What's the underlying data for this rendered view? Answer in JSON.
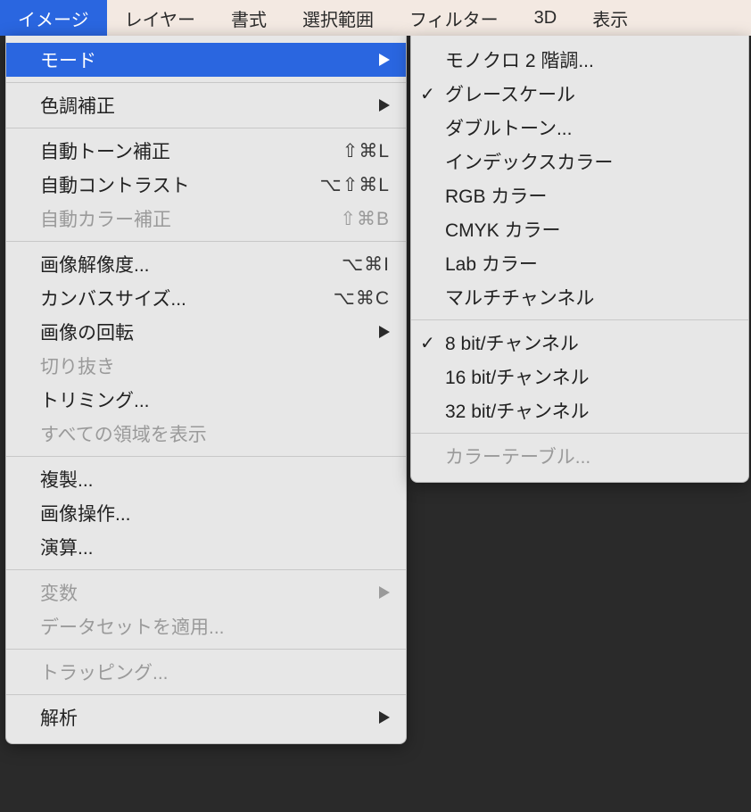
{
  "menubar": {
    "items": [
      {
        "label": "イメージ",
        "selected": true
      },
      {
        "label": "レイヤー"
      },
      {
        "label": "書式"
      },
      {
        "label": "選択範囲"
      },
      {
        "label": "フィルター"
      },
      {
        "label": "3D"
      },
      {
        "label": "表示"
      }
    ]
  },
  "imageMenu": {
    "groups": [
      [
        {
          "label": "モード",
          "submenu": true,
          "highlight": true
        }
      ],
      [
        {
          "label": "色調補正",
          "submenu": true
        }
      ],
      [
        {
          "label": "自動トーン補正",
          "shortcut": "⇧⌘L"
        },
        {
          "label": "自動コントラスト",
          "shortcut": "⌥⇧⌘L"
        },
        {
          "label": "自動カラー補正",
          "shortcut": "⇧⌘B",
          "disabled": true
        }
      ],
      [
        {
          "label": "画像解像度...",
          "shortcut": "⌥⌘I"
        },
        {
          "label": "カンバスサイズ...",
          "shortcut": "⌥⌘C"
        },
        {
          "label": "画像の回転",
          "submenu": true
        },
        {
          "label": "切り抜き",
          "disabled": true
        },
        {
          "label": "トリミング..."
        },
        {
          "label": "すべての領域を表示",
          "disabled": true
        }
      ],
      [
        {
          "label": "複製..."
        },
        {
          "label": "画像操作..."
        },
        {
          "label": "演算..."
        }
      ],
      [
        {
          "label": "変数",
          "submenu": true,
          "disabled": true
        },
        {
          "label": "データセットを適用...",
          "disabled": true
        }
      ],
      [
        {
          "label": "トラッピング...",
          "disabled": true
        }
      ],
      [
        {
          "label": "解析",
          "submenu": true
        }
      ]
    ]
  },
  "modeSubmenu": {
    "groups": [
      [
        {
          "label": "モノクロ 2 階調..."
        },
        {
          "label": "グレースケール",
          "checked": true
        },
        {
          "label": "ダブルトーン..."
        },
        {
          "label": "インデックスカラー"
        },
        {
          "label": "RGB カラー"
        },
        {
          "label": "CMYK カラー"
        },
        {
          "label": "Lab カラー"
        },
        {
          "label": "マルチチャンネル"
        }
      ],
      [
        {
          "label": "8 bit/チャンネル",
          "checked": true
        },
        {
          "label": "16 bit/チャンネル"
        },
        {
          "label": "32 bit/チャンネル"
        }
      ],
      [
        {
          "label": "カラーテーブル...",
          "disabled": true
        }
      ]
    ]
  }
}
